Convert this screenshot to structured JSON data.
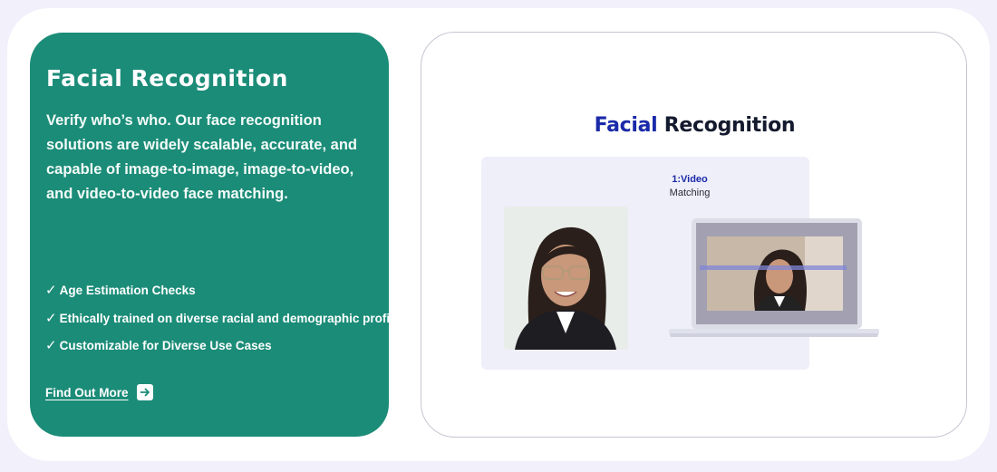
{
  "feature_card": {
    "title": "Facial Recognition",
    "description": "Verify who’s who. Our face recognition solutions are widely scalable, accurate, and capable of image-to-image, image-to-video, and video-to-video face matching.",
    "check_symbol": "✓",
    "features": [
      "Age Estimation Checks",
      "Ethically trained on diverse racial and demographic profiles",
      "Customizable for Diverse Use Cases"
    ],
    "cta_label": "Find Out More",
    "cta_icon": "arrow-right-icon",
    "background_color": "#1b8c78"
  },
  "preview": {
    "title_part1": "Facial",
    "title_part2": "Recognition",
    "match_line1": "1:Video",
    "match_line2": "Matching",
    "accent_color": "#1a2aa8"
  }
}
